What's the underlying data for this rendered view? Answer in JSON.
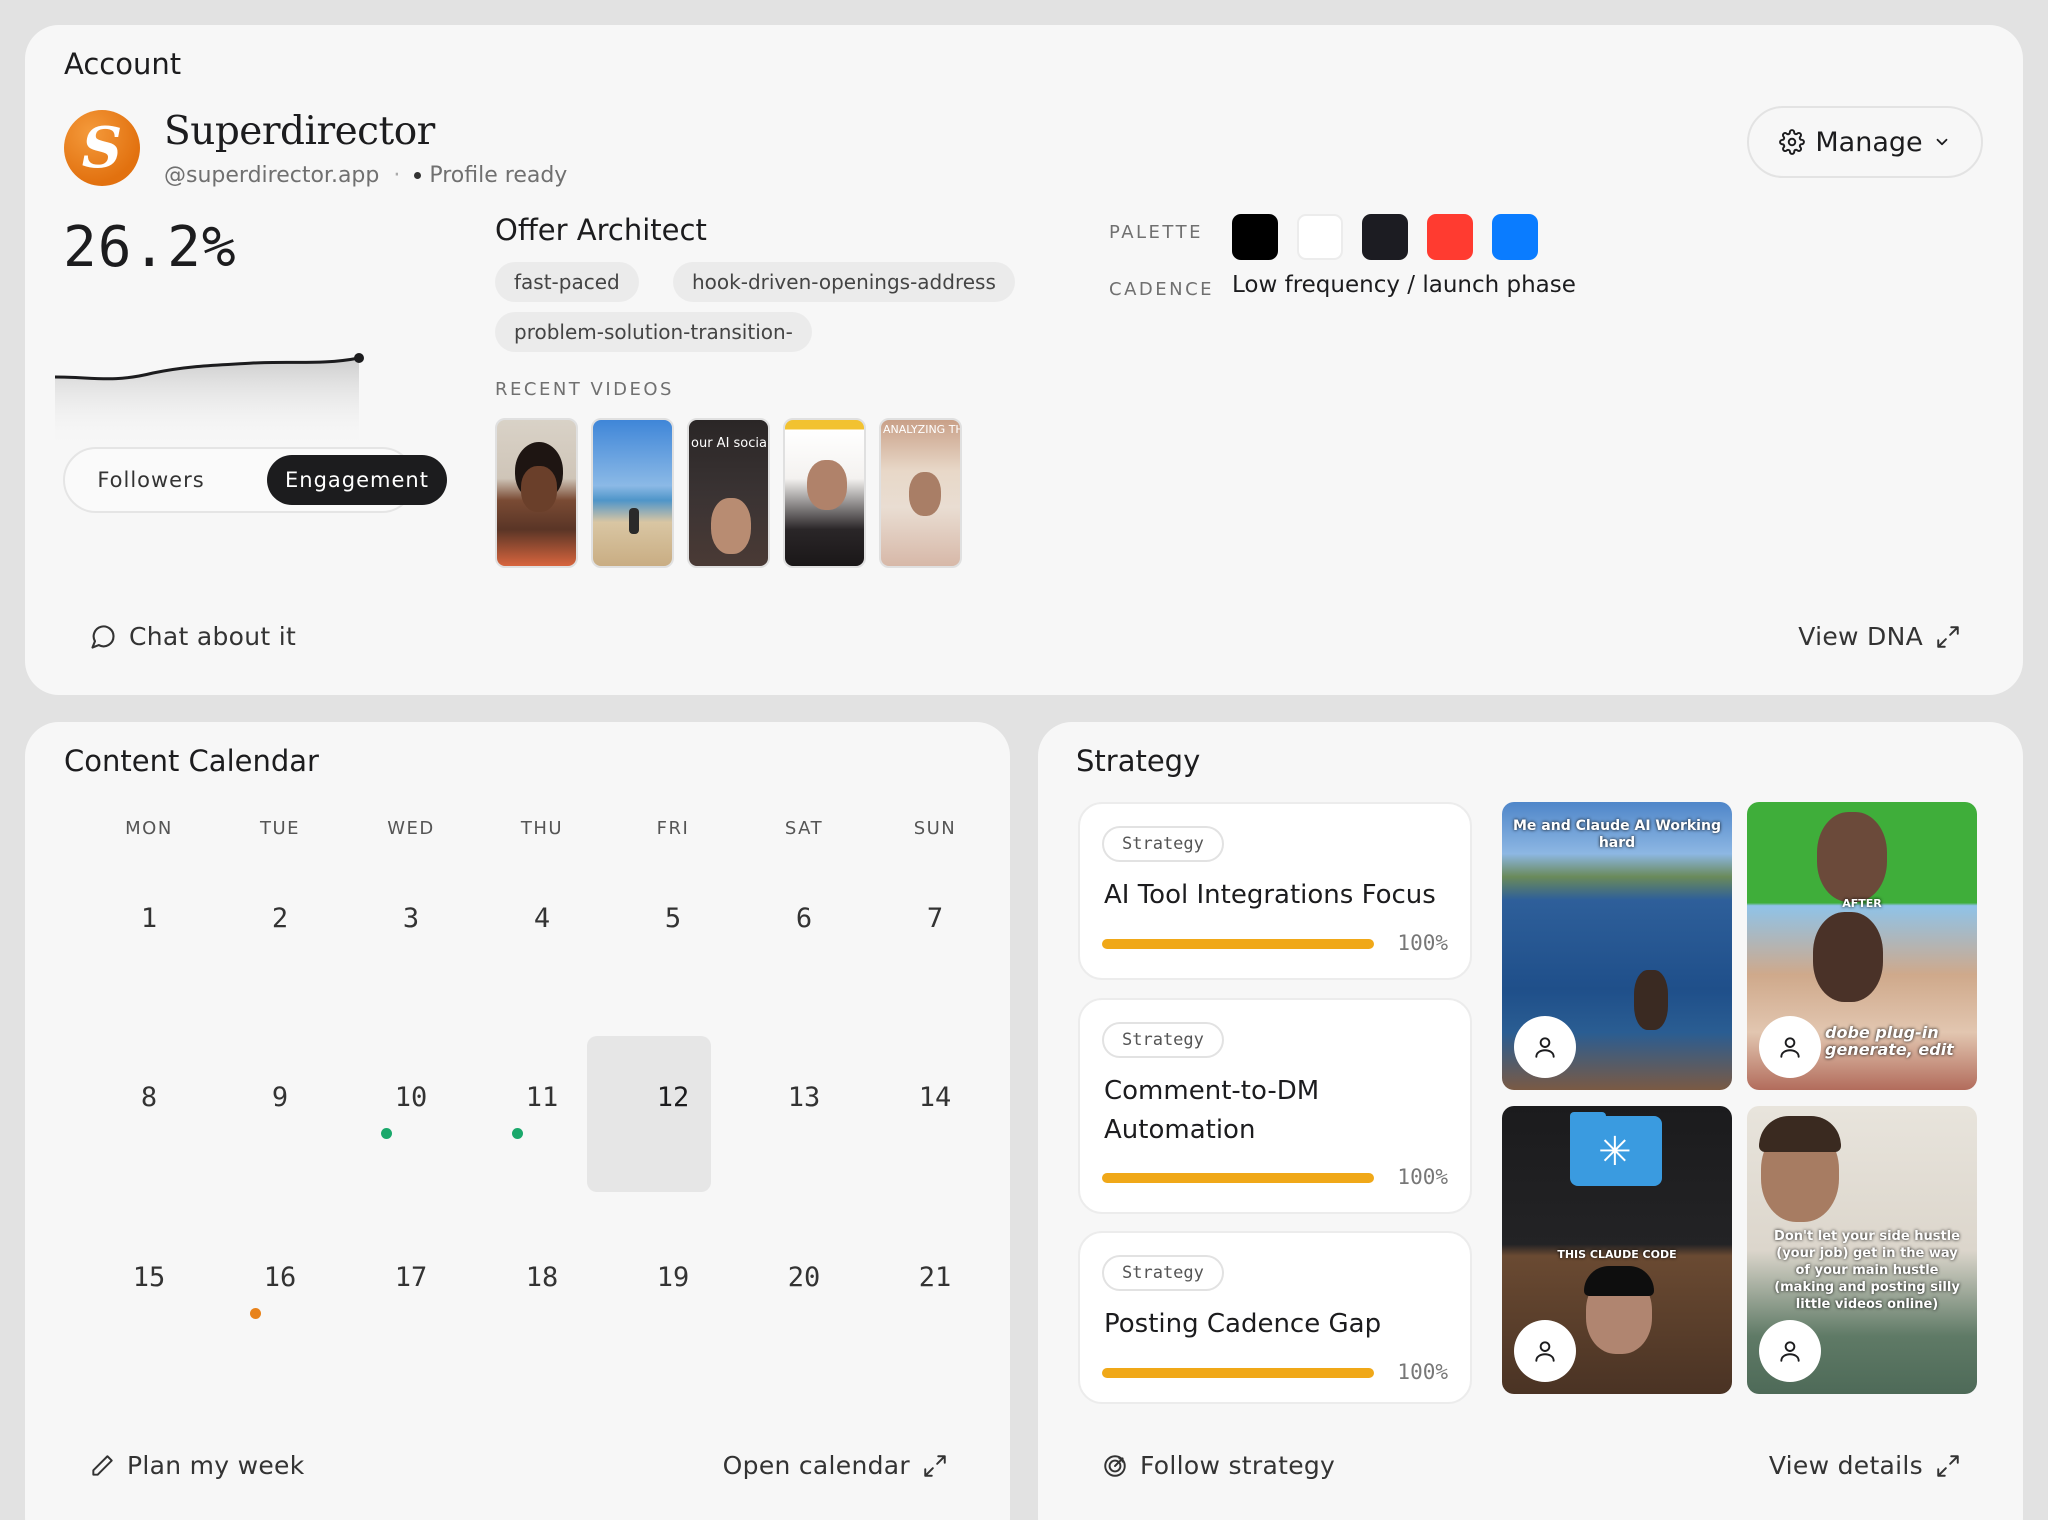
{
  "account": {
    "title": "Account",
    "logo_letter": "S",
    "name": "Superdirector",
    "handle": "@superdirector.app",
    "separator": "·",
    "status": "Profile ready",
    "manage_label": "Manage",
    "metric_value": "26.2%",
    "toggle": {
      "followers": "Followers",
      "engagement": "Engagement",
      "selected": "Engagement"
    },
    "offer_title": "Offer Architect",
    "tags": [
      "fast-paced",
      "hook-driven-openings-address",
      "problem-solution-transition-"
    ],
    "recent_videos_label": "RECENT VIDEOS",
    "recent_videos": [
      {
        "overlay": ""
      },
      {
        "overlay": ""
      },
      {
        "overlay": "our AI socia edia manag nd scriptwrit"
      },
      {
        "overlay": ""
      },
      {
        "overlay": "ANALYZING THEM..."
      }
    ],
    "palette_label": "PALETTE",
    "palette": [
      "#000000",
      "#ffffff",
      "#1c1c22",
      "#ff3b30",
      "#0a7cff"
    ],
    "cadence_label": "CADENCE",
    "cadence_value": "Low frequency / launch phase",
    "chat_label": "Chat about it",
    "view_dna_label": "View DNA"
  },
  "calendar": {
    "title": "Content Calendar",
    "weekdays": [
      "MON",
      "TUE",
      "WED",
      "THU",
      "FRI",
      "SAT",
      "SUN"
    ],
    "weeks": [
      [
        "1",
        "2",
        "3",
        "4",
        "5",
        "6",
        "7"
      ],
      [
        "8",
        "9",
        "10",
        "11",
        "12",
        "13",
        "14"
      ],
      [
        "15",
        "16",
        "17",
        "18",
        "19",
        "20",
        "21"
      ]
    ],
    "today": "12",
    "event_colors": {
      "published": "#1aa86b",
      "scheduled": "#e8821a"
    },
    "plan_label": "Plan my week",
    "open_label": "Open calendar"
  },
  "strategy": {
    "title": "Strategy",
    "items": [
      {
        "badge": "Strategy",
        "title": "AI Tool Integrations Focus",
        "percent": "100%",
        "progress": 1.0
      },
      {
        "badge": "Strategy",
        "title": "Comment-to-DM Automation",
        "percent": "100%",
        "progress": 1.0
      },
      {
        "badge": "Strategy",
        "title": "Posting Cadence Gap",
        "percent": "100%",
        "progress": 1.0
      }
    ],
    "images": [
      {
        "caption": "Me and Claude AI Working hard"
      },
      {
        "caption": "AFTER",
        "caption2": "dobe plug-in generate, edit"
      },
      {
        "caption": "THIS CLAUDE CODE"
      },
      {
        "caption": "Don't let your side hustle (your job) get in the way of your main hustle (making and posting silly little videos online)"
      }
    ],
    "follow_label": "Follow strategy",
    "details_label": "View details",
    "accent": "#f0a818"
  }
}
